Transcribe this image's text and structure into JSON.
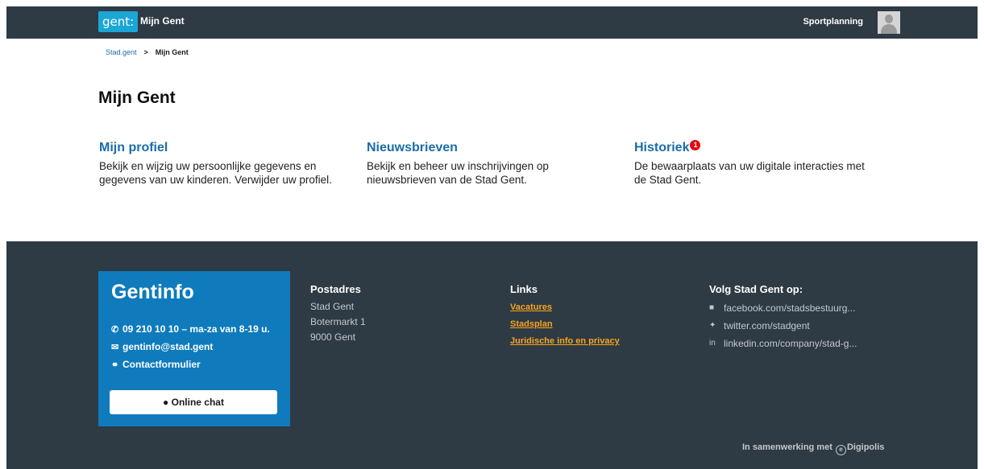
{
  "header": {
    "logo_text": "gent:",
    "app_title": "Mijn Gent",
    "user_name": "Sportplanning"
  },
  "breadcrumb": {
    "root": "Stad.gent",
    "separator": ">",
    "current": "Mijn Gent"
  },
  "page_title": "Mijn Gent",
  "cards": [
    {
      "title": "Mijn profiel",
      "description": "Bekijk en wijzig uw persoonlijke gegevens en gegevens van uw kinderen. Verwijder uw profiel."
    },
    {
      "title": "Nieuwsbrieven",
      "description": "Bekijk en beheer uw inschrijvingen op nieuwsbrieven van de Stad Gent."
    },
    {
      "title": "Historiek",
      "badge": "1",
      "description": "De bewaarplaats van uw digitale interacties met de Stad Gent."
    }
  ],
  "footer": {
    "gentinfo": {
      "title": "Gentinfo",
      "phone": "09 210 10 10 – ma-za van 8-19 u.",
      "email": "gentinfo@stad.gent",
      "contact": "Contactformulier",
      "chat_button": "Online chat"
    },
    "postadres": {
      "heading": "Postadres",
      "lines": [
        "Stad Gent",
        "Botermarkt 1",
        "9000 Gent"
      ]
    },
    "links": {
      "heading": "Links",
      "items": [
        "Vacatures",
        "Stadsplan",
        "Juridische info en privacy"
      ]
    },
    "social": {
      "heading": "Volg Stad Gent op:",
      "items": [
        {
          "icon": "facebook-icon",
          "text": "facebook.com/stadsbestuurg..."
        },
        {
          "icon": "twitter-icon",
          "text": "twitter.com/stadgent"
        },
        {
          "icon": "linkedin-icon",
          "text": "linkedin.com/company/stad-g..."
        }
      ]
    },
    "partner_prefix": "In samenwerking met",
    "partner_name": "Digipolis"
  },
  "colors": {
    "header_bg": "#2e3a44",
    "logo_bg": "#1ba6d6",
    "link": "#1b6da8",
    "gentinfo_bg": "#0f7bbd",
    "footer_link": "#f7a51d",
    "badge": "#e30613"
  }
}
